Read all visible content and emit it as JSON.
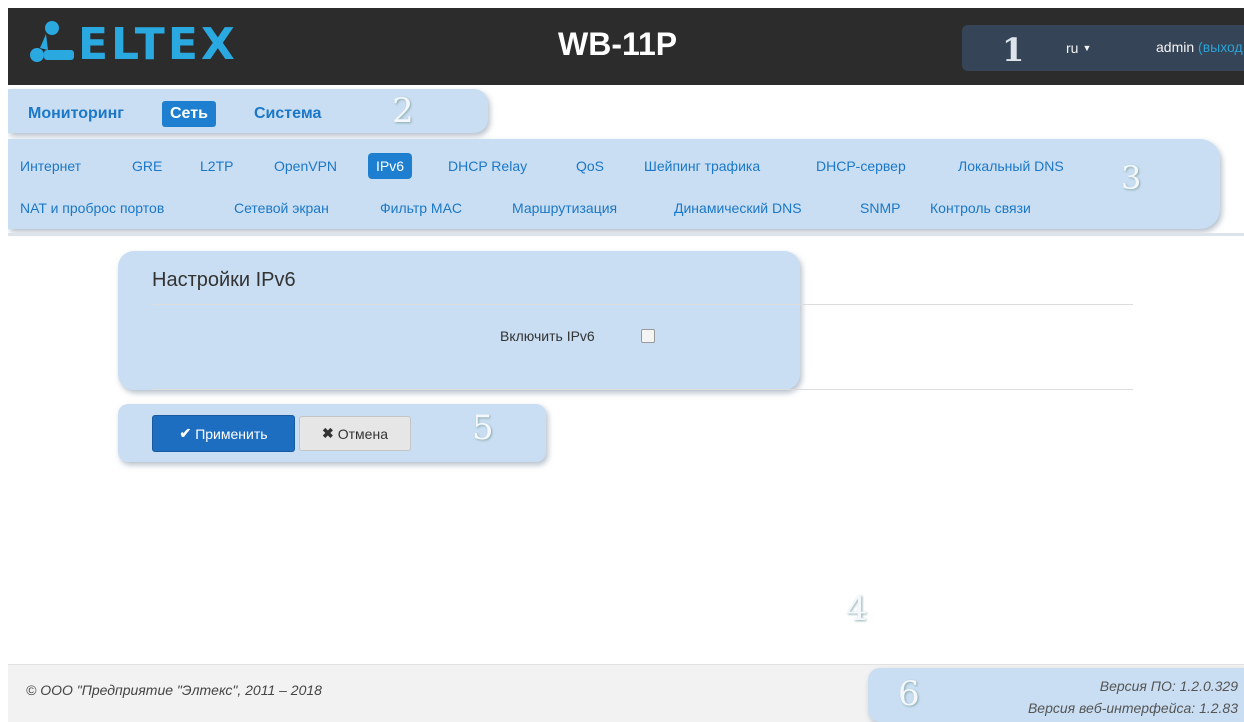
{
  "header": {
    "logo_text": "ELTEX",
    "device_title": "WB-11P",
    "callout": "1",
    "language": "ru",
    "user": "admin",
    "logout": "(выход"
  },
  "nav_primary": {
    "callout": "2",
    "tabs": [
      {
        "label": "Мониторинг",
        "active": false
      },
      {
        "label": "Сеть",
        "active": true
      },
      {
        "label": "Система",
        "active": false
      }
    ]
  },
  "nav_secondary": {
    "callout": "3",
    "row1": [
      {
        "label": "Интернет"
      },
      {
        "label": "GRE"
      },
      {
        "label": "L2TP"
      },
      {
        "label": "OpenVPN"
      },
      {
        "label": "IPv6",
        "active": true
      },
      {
        "label": "DHCP Relay"
      },
      {
        "label": "QoS"
      },
      {
        "label": "Шейпинг трафика"
      },
      {
        "label": "DHCP-сервер"
      },
      {
        "label": "Локальный DNS"
      }
    ],
    "row2": [
      {
        "label": "NAT и проброс портов"
      },
      {
        "label": "Сетевой экран"
      },
      {
        "label": "Фильтр MAC"
      },
      {
        "label": "Маршрутизация"
      },
      {
        "label": "Динамический DNS"
      },
      {
        "label": "SNMP"
      },
      {
        "label": "Контроль связи"
      }
    ]
  },
  "settings": {
    "callout": "4",
    "title": "Настройки IPv6",
    "enable_label": "Включить IPv6",
    "enabled": false
  },
  "actions": {
    "callout": "5",
    "apply_label": "Применить",
    "cancel_label": "Отмена"
  },
  "footer": {
    "callout": "6",
    "copyright": "© ООО \"Предприятие \"Элтекс\", 2011 – 2018",
    "fw_version": "Версия ПО: 1.2.0.329",
    "web_version": "Версия веб-интерфейса: 1.2.83"
  },
  "colors": {
    "header_bg": "#2c2c2c",
    "accent": "#1e7fd0",
    "logo": "#2aa9e0",
    "callout_bg": "#c9def2"
  },
  "icons": [
    "eltex-logo-icon",
    "caret-down-icon",
    "checkmark-icon",
    "close-icon"
  ]
}
